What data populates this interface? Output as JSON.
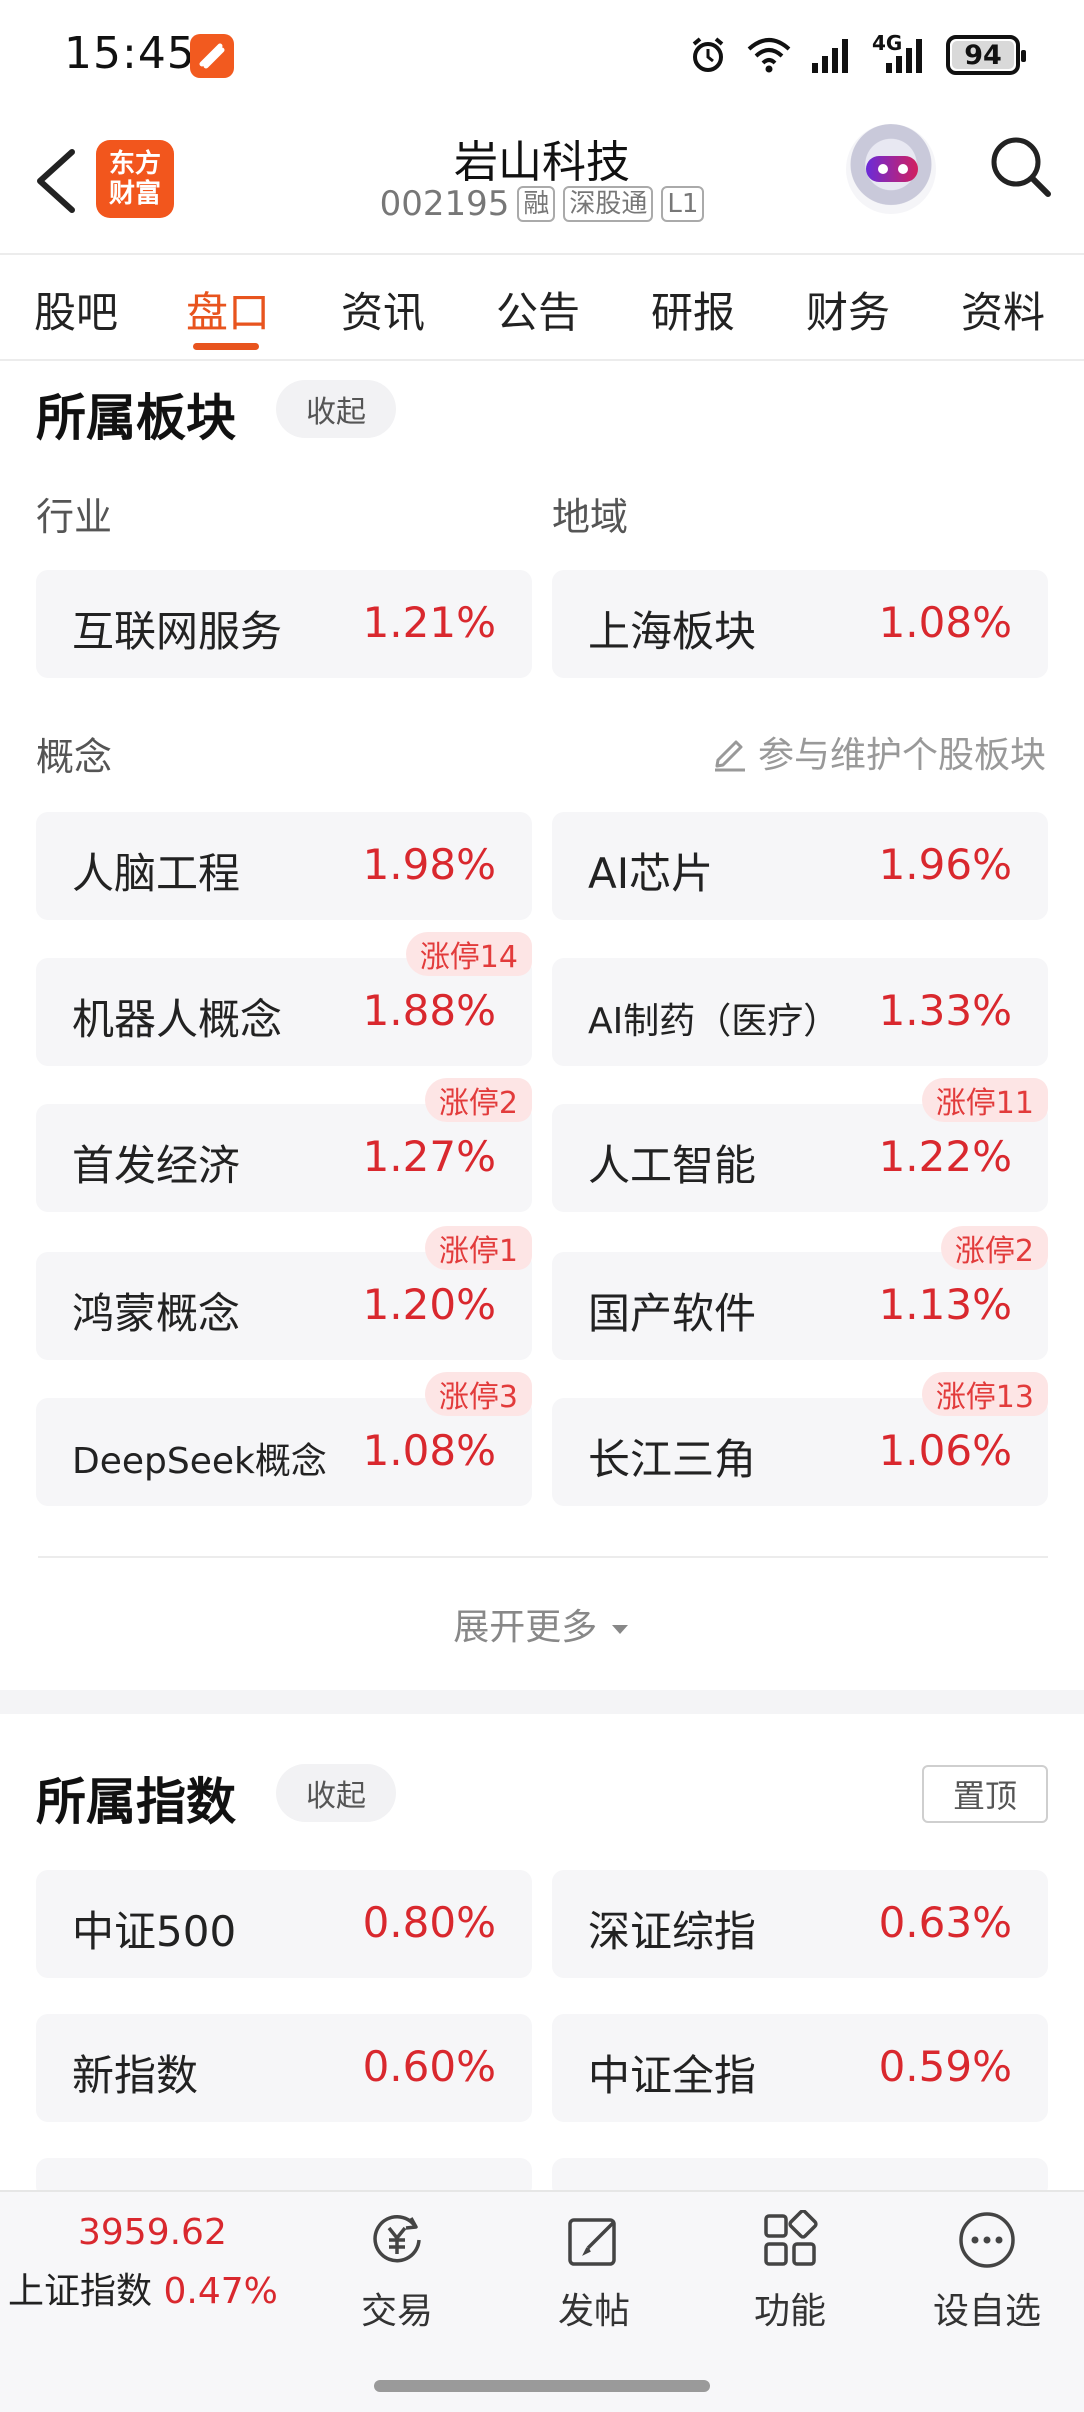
{
  "status_bar": {
    "time": "15:45",
    "network": "4G",
    "battery": "94",
    "battery_level": 0.94
  },
  "header": {
    "back_label": "back",
    "brand_logo": [
      "东方",
      "财富"
    ],
    "stock_name": "岩山科技",
    "stock_code": "002195",
    "tags": [
      "融",
      "深股通",
      "L1"
    ]
  },
  "tabs": [
    {
      "label": "股吧"
    },
    {
      "label": "盘口"
    },
    {
      "label": "资讯"
    },
    {
      "label": "公告"
    },
    {
      "label": "研报"
    },
    {
      "label": "财务"
    },
    {
      "label": "资料"
    }
  ],
  "active_tab": "盘口",
  "sectors": {
    "title": "所属板块",
    "collapse_label": "收起",
    "industry_label": "行业",
    "region_label": "地域",
    "industry": {
      "name": "互联网服务",
      "pct": "1.21%"
    },
    "region": {
      "name": "上海板块",
      "pct": "1.08%"
    },
    "concept_label": "概念",
    "maintain_link": "参与维护个股板块",
    "concepts": [
      {
        "name": "人脑工程",
        "pct": "1.98%",
        "badge": ""
      },
      {
        "name": "AI芯片",
        "pct": "1.96%",
        "badge": ""
      },
      {
        "name": "机器人概念",
        "pct": "1.88%",
        "badge": "涨停14"
      },
      {
        "name": "AI制药（医疗）",
        "pct": "1.33%",
        "badge": ""
      },
      {
        "name": "首发经济",
        "pct": "1.27%",
        "badge": "涨停2"
      },
      {
        "name": "人工智能",
        "pct": "1.22%",
        "badge": "涨停11"
      },
      {
        "name": "鸿蒙概念",
        "pct": "1.20%",
        "badge": "涨停1"
      },
      {
        "name": "国产软件",
        "pct": "1.13%",
        "badge": "涨停2"
      },
      {
        "name": "DeepSeek概念",
        "pct": "1.08%",
        "badge": "涨停3"
      },
      {
        "name": "长江三角",
        "pct": "1.06%",
        "badge": "涨停13"
      }
    ],
    "expand_label": "展开更多"
  },
  "indices": {
    "title": "所属指数",
    "collapse_label": "收起",
    "pin_label": "置顶",
    "items": [
      {
        "name": "中证500",
        "pct": "0.80%"
      },
      {
        "name": "深证综指",
        "pct": "0.63%"
      },
      {
        "name": "新指数",
        "pct": "0.60%"
      },
      {
        "name": "中证全指",
        "pct": "0.59%"
      }
    ]
  },
  "bottom_bar": {
    "index_value": "3959.62",
    "index_name": "上证指数",
    "index_change": "0.47%",
    "nav": [
      {
        "label": "交易",
        "icon": "trade-icon"
      },
      {
        "label": "发帖",
        "icon": "compose-icon"
      },
      {
        "label": "功能",
        "icon": "grid-icon"
      },
      {
        "label": "设自选",
        "icon": "more-icon"
      }
    ]
  },
  "colors": {
    "accent": "#e8541e",
    "up": "#d9282e",
    "badge_bg": "#fde5e5",
    "card_bg": "#f6f6f8"
  }
}
